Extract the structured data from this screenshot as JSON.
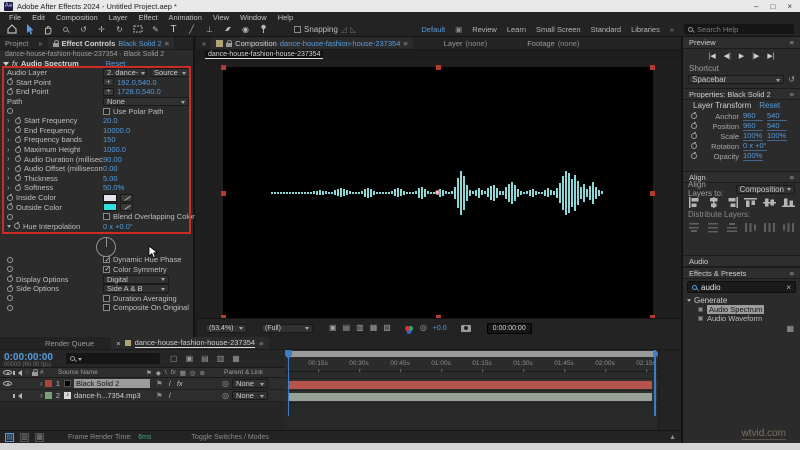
{
  "titlebar": {
    "app": "Ae",
    "title": "Adobe After Effects 2024 - Untitled Project.aep *",
    "minimize": "–",
    "maximize": "□",
    "close": "×"
  },
  "menubar": {
    "items": [
      "File",
      "Edit",
      "Composition",
      "Layer",
      "Effect",
      "Animation",
      "View",
      "Window",
      "Help"
    ]
  },
  "toolbar": {
    "snapping": "Snapping",
    "workspaces": {
      "active": "Default",
      "items": [
        "Review",
        "Learn",
        "Small Screen",
        "Standard",
        "Libraries"
      ],
      "more": "»"
    },
    "search_placeholder": "Search Help"
  },
  "effect_controls": {
    "tabs": {
      "project": "Project",
      "title": "Effect Controls",
      "target": "Black Solid 2"
    },
    "source_line": "dance-house-fashion-house-237354 · Black Solid 2",
    "effect": {
      "fx": "fx",
      "name": "Audio Spectrum",
      "reset": "Reset"
    },
    "rows": [
      {
        "label": "Audio Layer",
        "value": "2. dance-",
        "value2": "Source"
      },
      {
        "label": "Start Point",
        "value": "192.0,540.0"
      },
      {
        "label": "End Point",
        "value": "1728.0,540.0"
      },
      {
        "label": "Path",
        "value": "None"
      },
      {
        "label": "Use Polar Path",
        "checked": false
      },
      {
        "label": "Start Frequency",
        "value": "20.0"
      },
      {
        "label": "End Frequency",
        "value": "10000.0"
      },
      {
        "label": "Frequency bands",
        "value": "150"
      },
      {
        "label": "Maximum Height",
        "value": "1000.0"
      },
      {
        "label": "Audio Duration (millisecond",
        "value": "90.00"
      },
      {
        "label": "Audio Offset (milliseconds)",
        "value": "0.00"
      },
      {
        "label": "Thickness",
        "value": "5.00"
      },
      {
        "label": "Softness",
        "value": "50.0%"
      },
      {
        "label": "Inside Color",
        "color": "#e8e2ef"
      },
      {
        "label": "Outside Color",
        "color": "#30dfdf"
      },
      {
        "label": "Blend Overlapping Color",
        "checked": false
      },
      {
        "label": "Hue Interpolation",
        "value": "0 x +0.0°"
      }
    ],
    "options": [
      {
        "label": "Dynamic Hue Phase",
        "checked": true
      },
      {
        "label": "Color Symmetry",
        "checked": true
      },
      {
        "label": "Display Options",
        "value": "Digital"
      },
      {
        "label": "Side Options",
        "value": "Side A & B"
      },
      {
        "label": "Duration Averaging",
        "checked": false
      },
      {
        "label": "Composite On Original",
        "checked": false
      }
    ],
    "annotation_color": "#cf2b26"
  },
  "composition": {
    "tab": {
      "label": "Composition",
      "name": "dance-house-fashion-house-237354"
    },
    "tab_layer": {
      "label": "Layer",
      "value": "(none)"
    },
    "tab_footage": {
      "label": "Footage",
      "value": "(none)"
    },
    "breadcrumb": "dance-house-fashion-house-237354",
    "toolbar": {
      "zoom": "(53.4%)",
      "resolution": "(Full)",
      "exposure": "+0.0",
      "timecode": "0:00:00:00"
    },
    "waveform_color": "#8ed7d7",
    "handle_color": "#b33a2e",
    "waveform": [
      2,
      2,
      2,
      2,
      2,
      2,
      2,
      2,
      2,
      2,
      2,
      2,
      2,
      2,
      3,
      4,
      5,
      4,
      3,
      2,
      2,
      5,
      7,
      9,
      7,
      5,
      3,
      2,
      2,
      2,
      3,
      8,
      10,
      8,
      4,
      2,
      2,
      2,
      2,
      2,
      3,
      7,
      9,
      7,
      4,
      2,
      2,
      2,
      3,
      10,
      12,
      8,
      3,
      2,
      2,
      4,
      8,
      6,
      3,
      2,
      3,
      12,
      30,
      44,
      34,
      16,
      6,
      3,
      6,
      10,
      5,
      3,
      9,
      14,
      16,
      10,
      4,
      4,
      12,
      18,
      22,
      16,
      8,
      4,
      2,
      3,
      6,
      8,
      4,
      2,
      2,
      6,
      9,
      5,
      4,
      10,
      20,
      34,
      44,
      40,
      28,
      36,
      24,
      12,
      18,
      8,
      14,
      22,
      12,
      6,
      3
    ]
  },
  "preview": {
    "title": "Preview",
    "buttons": [
      "|◀",
      "◀|",
      "▶",
      "|▶",
      "▶|"
    ],
    "shortcut_label": "Shortcut",
    "shortcut": "Spacebar"
  },
  "properties": {
    "title": "Properties: Black Solid 2",
    "group": "Layer Transform",
    "reset": "Reset",
    "rows": [
      {
        "label": "Anchor",
        "v1": "960",
        "v2": "540"
      },
      {
        "label": "Position",
        "v1": "960",
        "v2": "540"
      },
      {
        "label": "Scale",
        "v1": "100%",
        "v2": "100%"
      },
      {
        "label": "Rotation",
        "v1": "0 x +0°",
        "v2": ""
      },
      {
        "label": "Opacity",
        "v1": "100%",
        "v2": ""
      }
    ]
  },
  "align": {
    "title": "Align",
    "to_label": "Align Layers to:",
    "to_value": "Composition",
    "distribute_label": "Distribute Layers:"
  },
  "audio_panel": {
    "title": "Audio"
  },
  "effects_presets": {
    "title": "Effects & Presets",
    "search": "audio",
    "clear": "×",
    "group": "Generate",
    "items": [
      {
        "name": "Audio Spectrum"
      },
      {
        "name": "Audio Waveform"
      }
    ]
  },
  "timeline": {
    "tabs": {
      "render_queue": "Render Queue",
      "comp": "dance-house-fashion-house-237354",
      "close": "×"
    },
    "timecode": "0:00:00:00",
    "frames": "00000 (60.00 fps)",
    "columns": {
      "num": "#",
      "source": "Source Name",
      "parent": "Parent & Link"
    },
    "layers": [
      {
        "num": "1",
        "name": "Black Solid 2",
        "parent": "None",
        "label_color": "#a94438"
      },
      {
        "num": "2",
        "name": "dance-h...7354.mp3",
        "parent": "None",
        "label_color": "#7d9d7d"
      }
    ],
    "ruler": [
      "00:15s",
      "00:30s",
      "00:45s",
      "01:00s",
      "01:15s",
      "01:30s",
      "01:45s",
      "02:00s",
      "02:15s"
    ],
    "bar_colors": {
      "solid": "#b5534d",
      "audio": "#97a297"
    },
    "footer": {
      "render_label": "Frame Render Time:",
      "render_value": "6ms",
      "toggle": "Toggle Switches / Modes"
    }
  },
  "watermark": "wtvid.com"
}
